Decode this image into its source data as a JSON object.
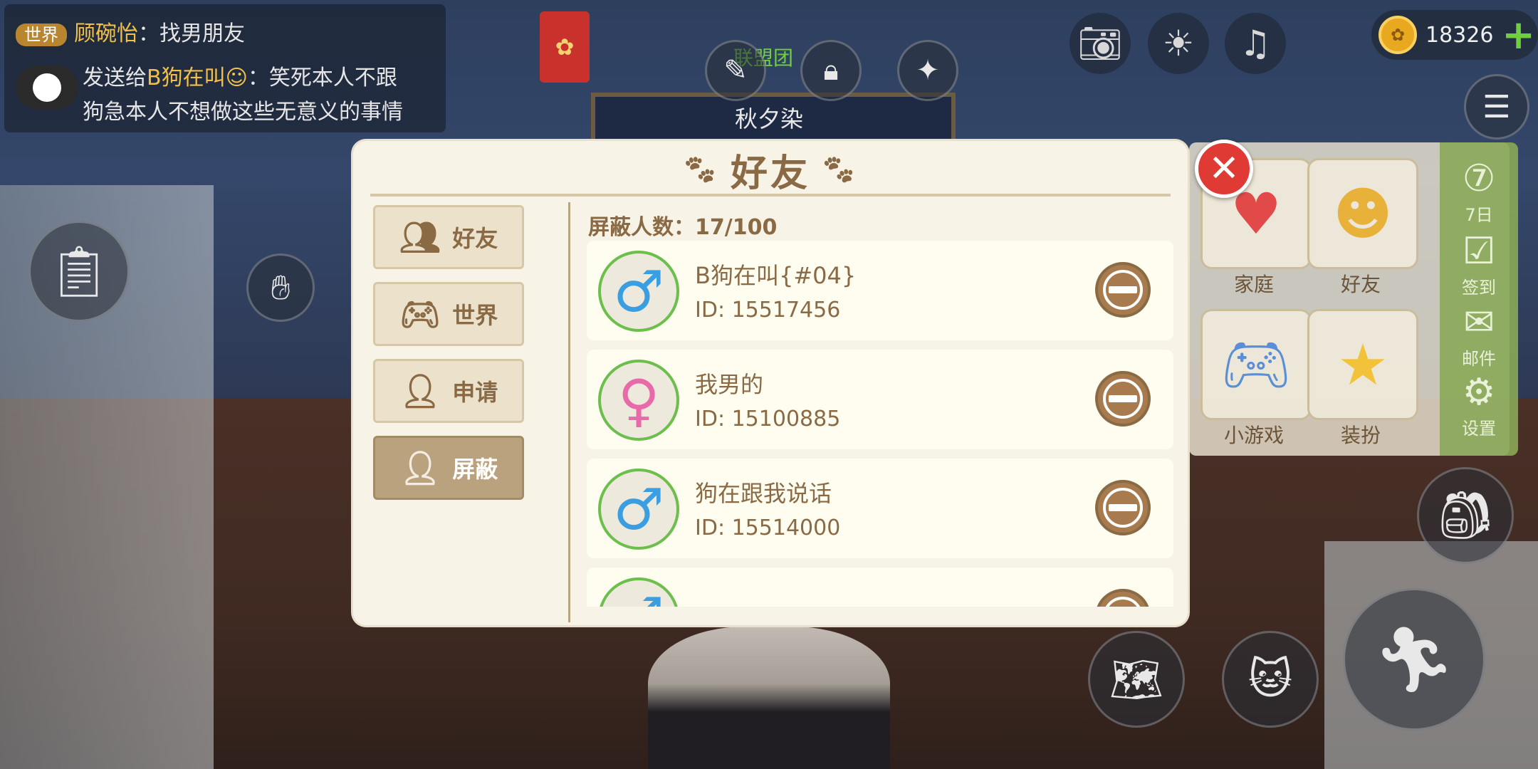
{
  "chat": {
    "line1_channel": "世界",
    "line1_user": "顾碗怡",
    "line1_msg": "：找男朋友",
    "line2_prefix": "发送给",
    "line2_user": "B狗在叫",
    "line2_msg": "：笑死本人不跟",
    "line3": "狗急本人不想做这些无意义的事情"
  },
  "scene": {
    "player_name": "秋夕染",
    "guild_tag": "联盟团"
  },
  "coins": {
    "value": "18326"
  },
  "right_menu": {
    "tiles": [
      {
        "label": "家庭"
      },
      {
        "label": "好友"
      },
      {
        "label": "小游戏"
      },
      {
        "label": "装扮"
      }
    ],
    "strip": [
      {
        "label": "7日"
      },
      {
        "label": "签到"
      },
      {
        "label": "邮件"
      },
      {
        "label": "设置"
      }
    ]
  },
  "dialog": {
    "title": "好友",
    "tabs": [
      {
        "label": "好友"
      },
      {
        "label": "世界"
      },
      {
        "label": "申请"
      },
      {
        "label": "屏蔽"
      }
    ],
    "active_tab": "屏蔽",
    "blocked_count": "屏蔽人数：17/100",
    "rows": [
      {
        "name": "B狗在叫{#04}",
        "id": "ID: 15517456",
        "gender": "male",
        "symbol": "♂"
      },
      {
        "name": "我男的",
        "id": "ID: 15100885",
        "gender": "female",
        "symbol": "♀"
      },
      {
        "name": "狗在跟我说话",
        "id": "ID: 15514000",
        "gender": "male",
        "symbol": "♂"
      },
      {
        "name": "",
        "id": "",
        "gender": "male",
        "symbol": "♂"
      }
    ]
  },
  "colors": {
    "accent": "#8a6a45",
    "active_tab": "#bba27f",
    "close": "#e03a35",
    "male": "#3b9ee0",
    "female": "#e86aa9"
  }
}
